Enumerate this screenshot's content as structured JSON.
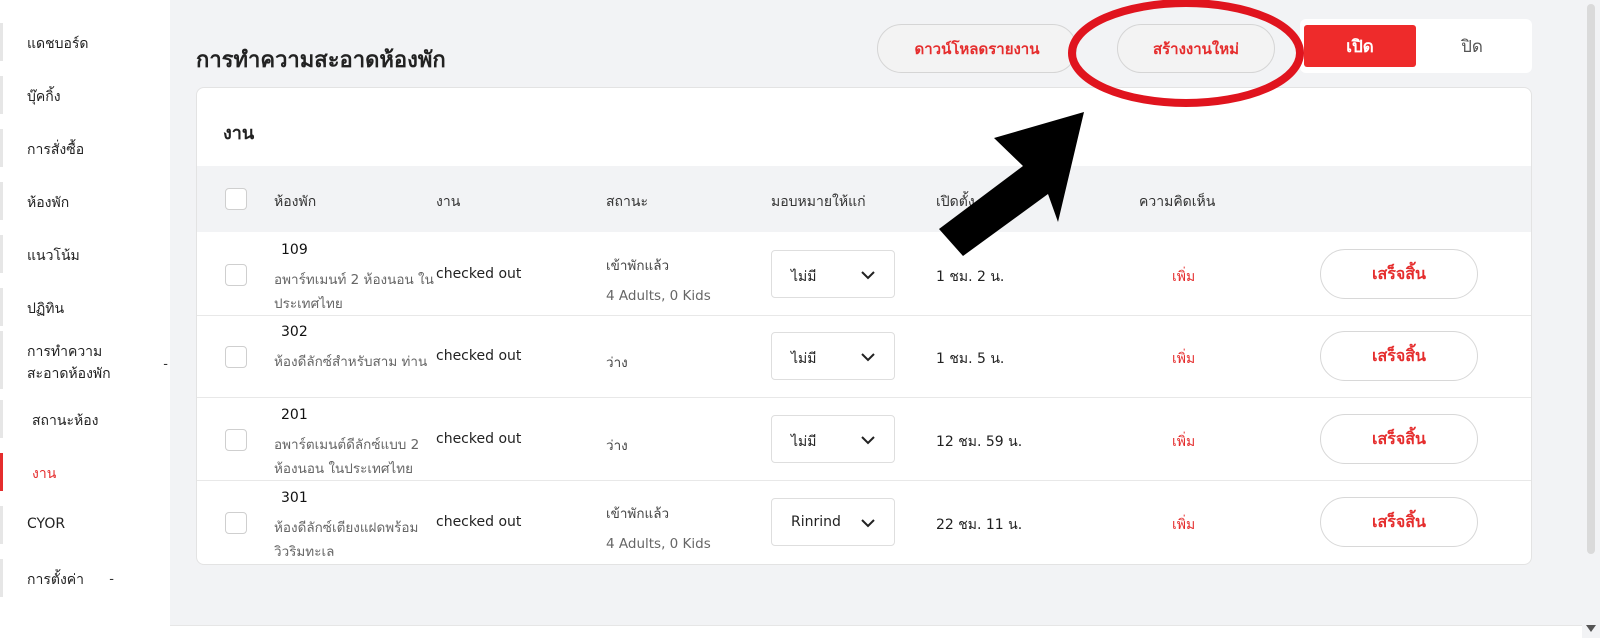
{
  "sidebar": {
    "items": [
      {
        "label": "แดชบอร์ด"
      },
      {
        "label": "บุ๊คกิ้ง"
      },
      {
        "label": "การสั่งซื้อ"
      },
      {
        "label": "ห้องพัก"
      },
      {
        "label": "แนวโน้ม"
      },
      {
        "label": "ปฏิทิน"
      },
      {
        "label": "การทำความสะอาดห้องพัก",
        "line1": "การทำความ",
        "line2": "สะอาดห้องพัก",
        "dash": "-"
      },
      {
        "label": "สถานะห้อง"
      },
      {
        "label": "งาน"
      },
      {
        "label": "CYOR"
      },
      {
        "label": "การตั้งค่า",
        "dash": "-"
      }
    ]
  },
  "header": {
    "title": "การทำความสะอาดห้องพัก",
    "download_label": "ดาวน์โหลดรายงาน",
    "create_label": "สร้างงานใหม่",
    "toggle_on_label": "เปิด",
    "toggle_off_label": "ปิด"
  },
  "card": {
    "title": "งาน",
    "columns": [
      "ห้องพัก",
      "งาน",
      "สถานะ",
      "มอบหมายให้แก่",
      "เปิดตั้ง",
      "ความคิดเห็น"
    ],
    "rows": [
      {
        "room": "109",
        "room_type": "อพาร์ทเมนท์ 2 ห้องนอน ในประเทศไทย",
        "task": "checked out",
        "status": "เข้าพักแล้ว",
        "status_detail": "4 Adults, 0 Kids",
        "assignee": "ไม่มี",
        "time": "1 ชม. 2 น.",
        "comment": "เพิ่ม",
        "done_label": "เสร็จสิ้น"
      },
      {
        "room": "302",
        "room_type": "ห้องดีลักซ์สำหรับสาม ท่าน",
        "task": "checked out",
        "status": "ว่าง",
        "status_detail": "",
        "assignee": "ไม่มี",
        "time": "1 ชม. 5 น.",
        "comment": "เพิ่ม",
        "done_label": "เสร็จสิ้น"
      },
      {
        "room": "201",
        "room_type": "อพาร์ตเมนต์ดีลักซ์แบบ 2 ห้องนอน ในประเทศไทย",
        "task": "checked out",
        "status": "ว่าง",
        "status_detail": "",
        "assignee": "ไม่มี",
        "time": "12 ชม. 59 น.",
        "comment": "เพิ่ม",
        "done_label": "เสร็จสิ้น"
      },
      {
        "room": "301",
        "room_type": "ห้องดีลักซ์เตียงแฝดพร้อม วิวริมทะเล",
        "task": "checked out",
        "status": "เข้าพักแล้ว",
        "status_detail": "4 Adults, 0 Kids",
        "assignee": "Rinrind",
        "time": "22 ชม. 11 น.",
        "comment": "เพิ่ม",
        "done_label": "เสร็จสิ้น"
      }
    ]
  },
  "colors": {
    "accent": "#e52d2d",
    "toggle_active": "#ee2b2b",
    "annotation_circle": "#e0141e",
    "annotation_arrow": "#000000"
  },
  "icons": [
    "chevron-down-icon",
    "arrow-annotation",
    "circle-annotation",
    "scroll-down-arrow-icon"
  ]
}
